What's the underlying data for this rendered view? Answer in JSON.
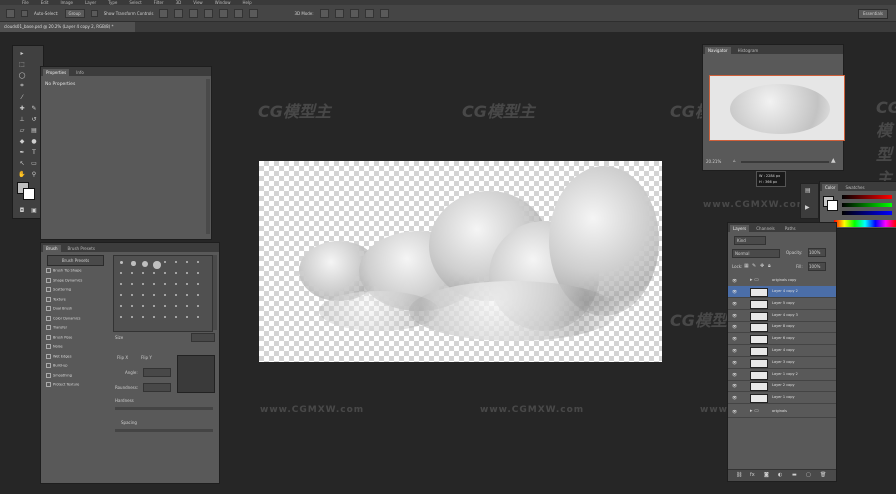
{
  "menu": [
    "File",
    "Edit",
    "Image",
    "Layer",
    "Type",
    "Select",
    "Filter",
    "3D",
    "View",
    "Window",
    "Help"
  ],
  "options": {
    "auto_select": "Auto-Select:",
    "auto_select_value": "Group",
    "show_transform": "Show Transform Controls",
    "mode_3d": "3D Mode:",
    "workspace": "Essentials"
  },
  "document": {
    "tab_title": "clouds01_base.psd @ 20.2% (Layer 4 copy 2, RGB/8) *"
  },
  "properties": {
    "tabs": [
      "Properties",
      "Info"
    ],
    "message": "No Properties"
  },
  "brush": {
    "tabs": [
      "Brush",
      "Brush Presets"
    ],
    "preset_button": "Brush Presets",
    "items": [
      "Brush Tip Shape",
      "Shape Dynamics",
      "Scattering",
      "Texture",
      "Dual Brush",
      "Color Dynamics",
      "Transfer",
      "Brush Pose",
      "Noise",
      "Wet Edges",
      "Build-up",
      "Smoothing",
      "Protect Texture"
    ],
    "size_label": "Size",
    "flip_x": "Flip X",
    "flip_y": "Flip Y",
    "angle": "Angle:",
    "roundness": "Roundness:",
    "hardness": "Hardness",
    "spacing": "Spacing"
  },
  "navigator": {
    "tabs": [
      "Navigator",
      "Histogram"
    ],
    "zoom": "20.21%"
  },
  "readout": {
    "w": "W : 2284 px",
    "h": "H : 366 px"
  },
  "color": {
    "tabs": [
      "Color",
      "Swatches"
    ]
  },
  "layers": {
    "tabs": [
      "Layers",
      "Channels",
      "Paths"
    ],
    "kind": "Kind",
    "blend": "Normal",
    "opacity_label": "Opacity:",
    "opacity": "100%",
    "lock_label": "Lock:",
    "fill_label": "Fill:",
    "fill": "100%",
    "group_name": "originals copy",
    "rows": [
      "Layer 4 copy 2",
      "Layer 5 copy",
      "Layer 4 copy 3",
      "Layer 8 copy",
      "Layer 6 copy",
      "Layer 4 copy",
      "Layer 3 copy",
      "Layer 1 copy 2",
      "Layer 2 copy",
      "Layer 1 copy"
    ],
    "group2": "originals"
  },
  "watermark": {
    "logo": "CG模型主",
    "url": "www.CGMXW.com"
  },
  "colors": {
    "accent": "#4b6ea8",
    "nav_frame": "#d0603a"
  }
}
